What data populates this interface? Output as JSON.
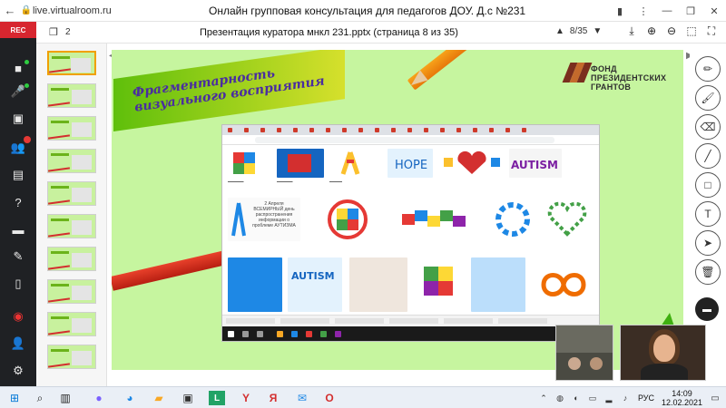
{
  "browser": {
    "url": "live.virtualroom.ru",
    "title": "Онлайн групповая консультация для педагогов ДОУ. Д.с №231"
  },
  "sidebar": {
    "rec_label": "REC"
  },
  "presentation": {
    "thumbs_count": "2",
    "file_title": "Презентация куратора мнкл 231.pptx (страница 8 из 35)",
    "page_indicator": "8/35"
  },
  "slide": {
    "heading_line1": "Фрагментарность",
    "heading_line2": "визуального восприятия",
    "logo_line1": "ФОНД",
    "logo_line2": "ПРЕЗИДЕНТСКИХ",
    "logo_line3": "ГРАНТОВ",
    "inner_card_text": "2 Апреля ВСЕМИРНЫЙ день распространения информации о проблеме АУТИЗМА",
    "inner_tiles": [
      "AUTISM",
      "AUTISM",
      "HOPE"
    ]
  },
  "taskbar": {
    "language": "РУС",
    "time": "14:09",
    "date": "12.02.2021"
  },
  "colors": {
    "rec_red": "#d7262f",
    "slide_bg": "#c6f59f",
    "heading_text": "#4a2da0"
  }
}
